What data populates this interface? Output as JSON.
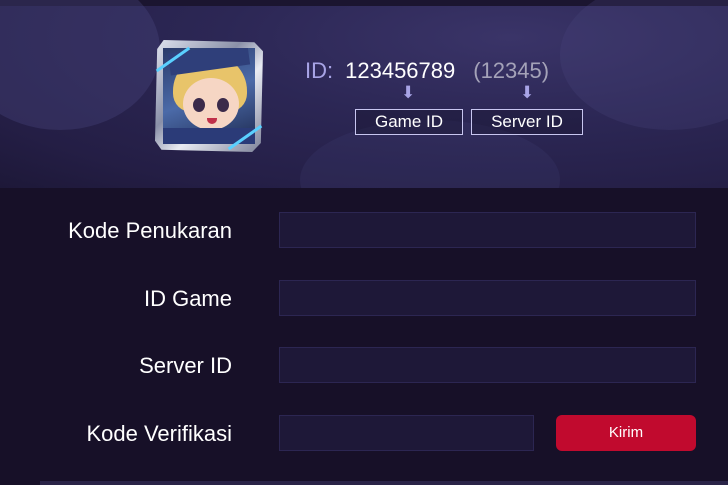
{
  "header": {
    "id_label": "ID:",
    "game_id_value": "123456789",
    "server_id_value": "(12345)",
    "arrow_glyph": "⬇",
    "game_id_tag": "Game ID",
    "server_id_tag": "Server ID",
    "avatar_icon": "hero-avatar-icon"
  },
  "form": {
    "redeem_code_label": "Kode Penukaran",
    "game_id_label": "ID Game",
    "server_id_label": "Server ID",
    "verification_code_label": "Kode Verifikasi",
    "redeem_code_value": "",
    "game_id_value": "",
    "server_id_value": "",
    "verification_code_value": "",
    "submit_label": "Kirim"
  },
  "colors": {
    "page_background": "#171028",
    "header_background": "#2c2755",
    "accent_label": "#a8a4e6",
    "input_background": "#1e1838",
    "submit_button": "#c10a2e"
  }
}
